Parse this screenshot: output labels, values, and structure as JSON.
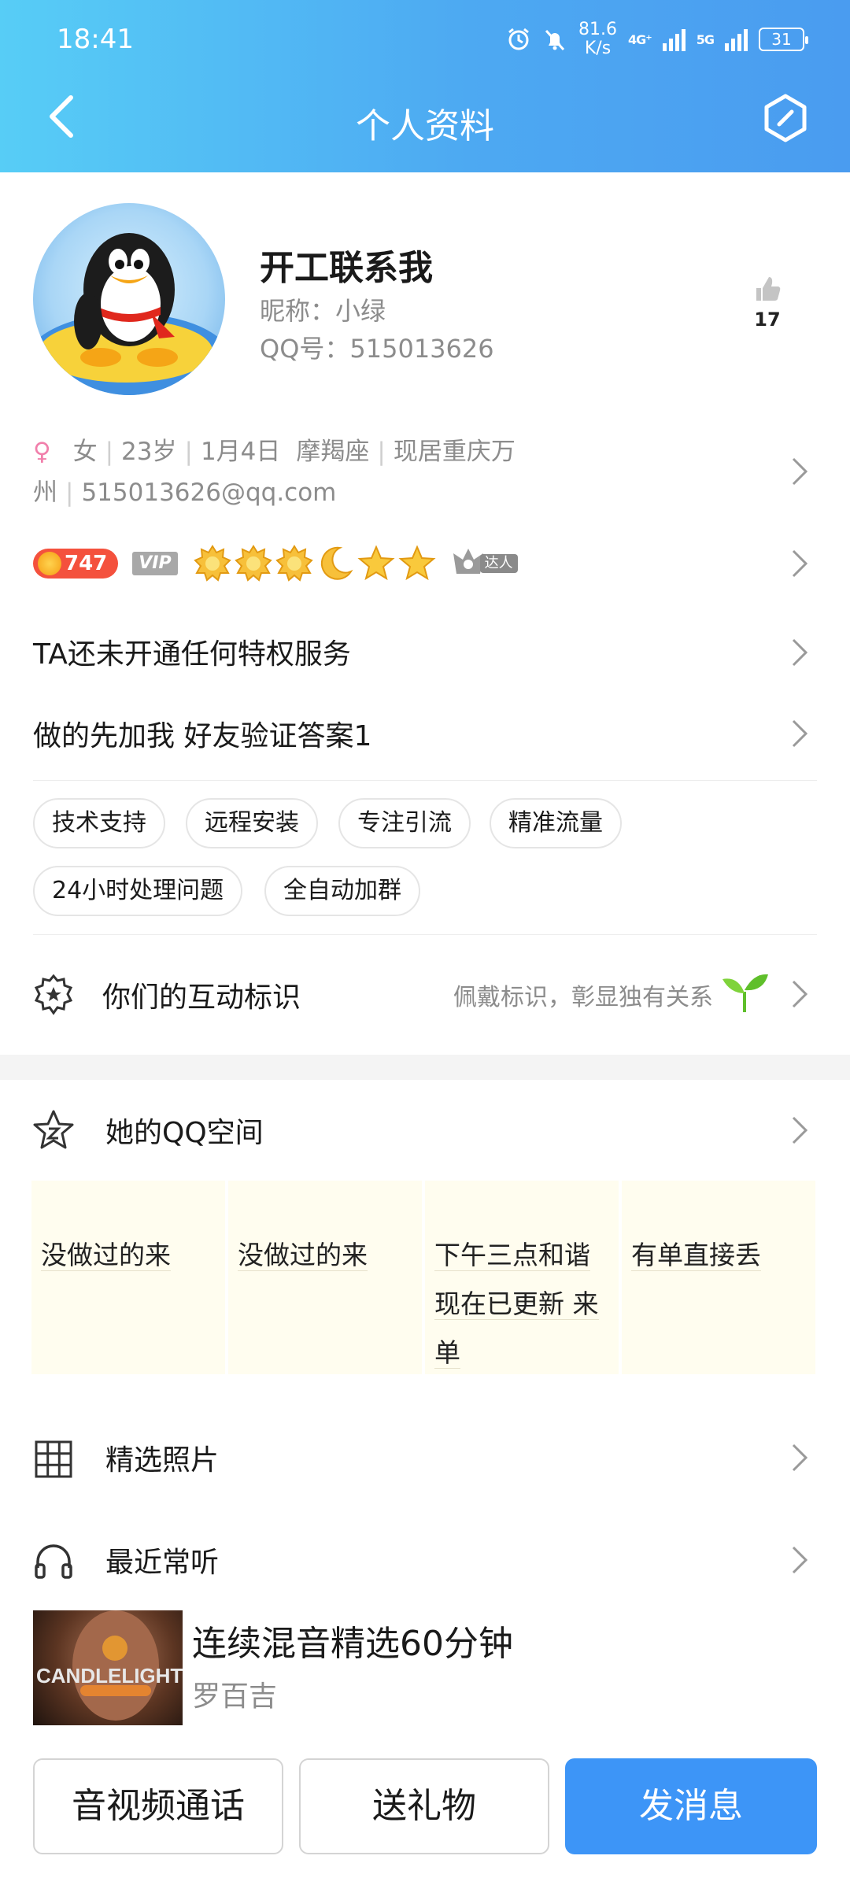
{
  "status_bar": {
    "time": "18:41",
    "net_speed_value": "81.6",
    "net_speed_unit": "K/s",
    "sig1": "4G⁺",
    "sig2": "5G",
    "battery": "31"
  },
  "header": {
    "title": "个人资料"
  },
  "profile": {
    "name": "开工联系我",
    "nickname": "昵称：小绿",
    "qq_number": "QQ号：515013626",
    "like_count": "17"
  },
  "info": {
    "gender": "女",
    "age": "23岁",
    "birthday": "1月4日",
    "zodiac": "摩羯座",
    "location": "现居重庆万州",
    "email": "515013626@qq.com"
  },
  "badges": {
    "level": "747",
    "vip": "VIP",
    "daren": "达人"
  },
  "privilege_text": "TA还未开通任何特权服务",
  "signature": "做的先加我 好友验证答案1",
  "tags": [
    "技术支持",
    "远程安装",
    "专注引流",
    "精准流量",
    "24小时处理问题",
    "全自动加群"
  ],
  "interaction": {
    "label": "你们的互动标识",
    "hint": "佩戴标识，彰显独有关系"
  },
  "qzone": {
    "label": "她的QQ空间",
    "posts": [
      "没做过的来",
      "没做过的来",
      "下午三点和谐现在已更新 来单",
      "有单直接丢"
    ]
  },
  "photos_label": "精选照片",
  "music": {
    "label": "最近常听",
    "song_title": "连续混音精选60分钟",
    "artist": "罗百吉",
    "album_text": "CANDLELIGHT"
  },
  "actions": {
    "call": "音视频通话",
    "gift": "送礼物",
    "message": "发消息"
  },
  "colors": {
    "header_start": "#57cdf6",
    "header_end": "#4a9cf0",
    "primary": "#3d95f7",
    "level_pill": "#f4513d",
    "female": "#f17fab"
  }
}
